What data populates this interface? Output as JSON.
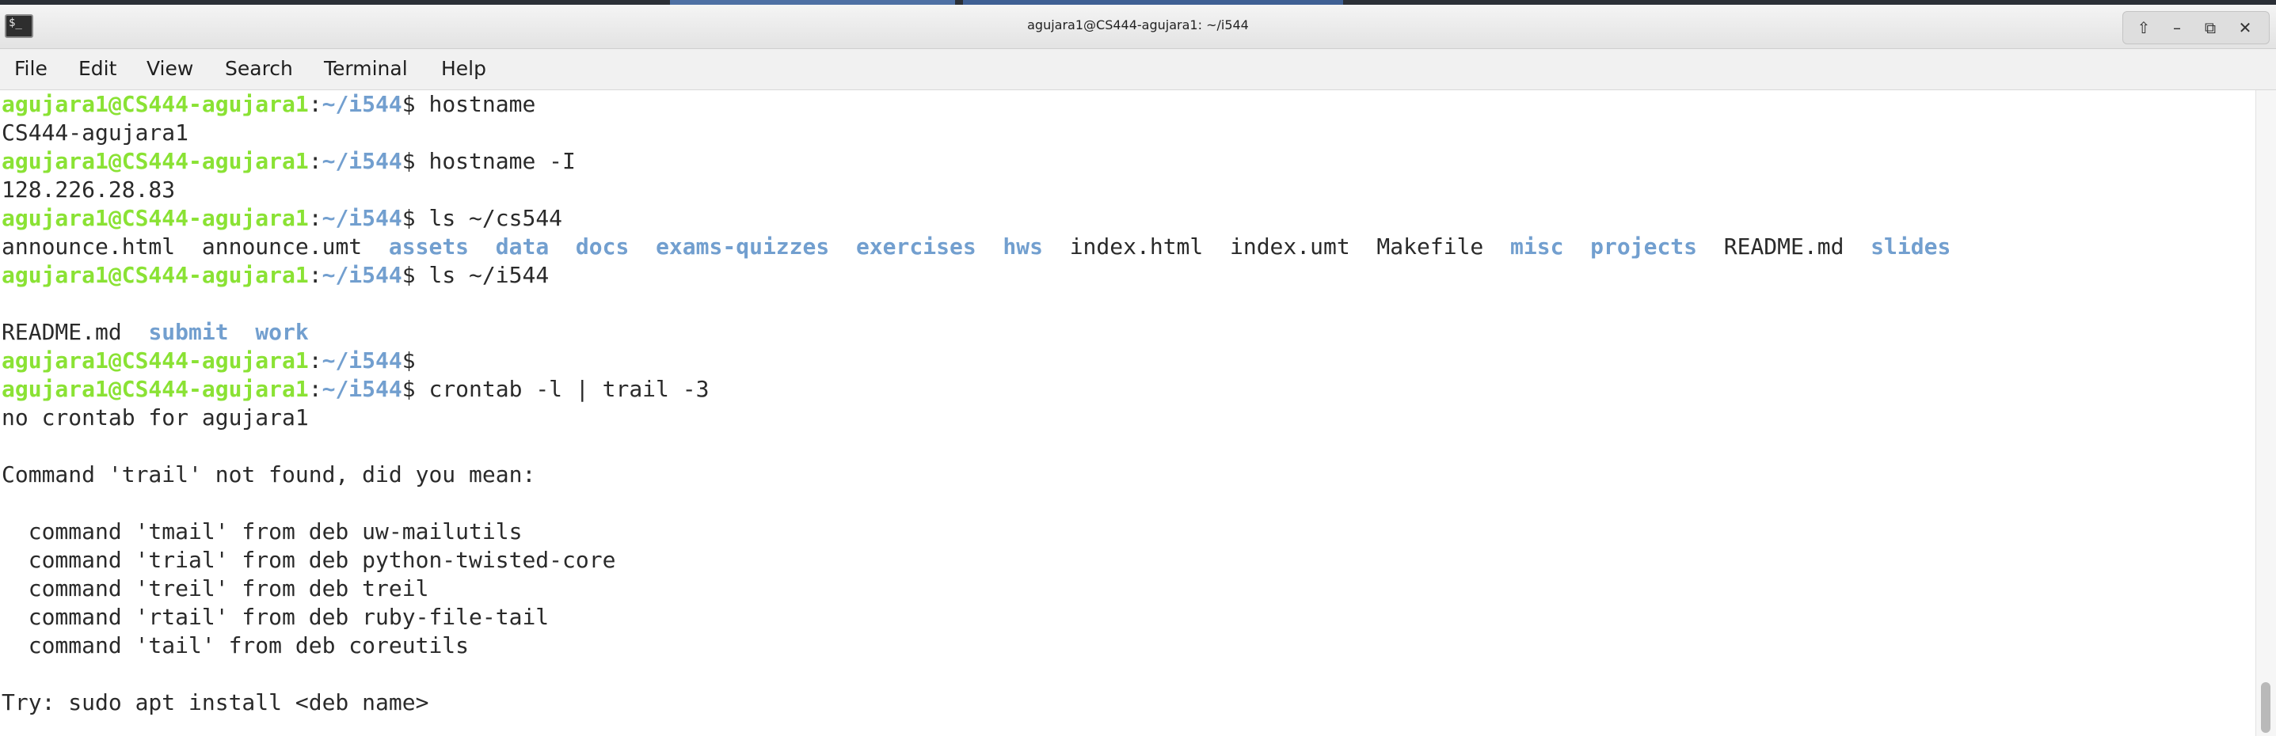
{
  "window": {
    "title": "agujara1@CS444-agujara1: ~/i544",
    "app_icon_glyph": "$_",
    "controls": {
      "up": "⇧",
      "minimize": "–",
      "maximize": "⧉",
      "close": "✕"
    }
  },
  "menu": [
    "File",
    "Edit",
    "View",
    "Search",
    "Terminal",
    "Help"
  ],
  "terminal": {
    "prompt_user": "agujara1@CS444-agujara1",
    "lines": [
      {
        "kind": "prompt",
        "path": "~/i544",
        "cmd": " hostname"
      },
      {
        "kind": "output",
        "text": "CS444-agujara1"
      },
      {
        "kind": "prompt",
        "path": "~/i544",
        "cmd": " hostname -I"
      },
      {
        "kind": "output",
        "text": "128.226.28.83"
      },
      {
        "kind": "prompt",
        "path": "~/i544",
        "cmd": " ls ~/cs544"
      },
      {
        "kind": "ls",
        "items": [
          {
            "name": "announce.html",
            "dir": false
          },
          {
            "name": "announce.umt",
            "dir": false
          },
          {
            "name": "assets",
            "dir": true
          },
          {
            "name": "data",
            "dir": true
          },
          {
            "name": "docs",
            "dir": true
          },
          {
            "name": "exams-quizzes",
            "dir": true
          },
          {
            "name": "exercises",
            "dir": true
          },
          {
            "name": "hws",
            "dir": true
          },
          {
            "name": "index.html",
            "dir": false
          },
          {
            "name": "index.umt",
            "dir": false
          },
          {
            "name": "Makefile",
            "dir": false
          },
          {
            "name": "misc",
            "dir": true
          },
          {
            "name": "projects",
            "dir": true
          },
          {
            "name": "README.md",
            "dir": false
          },
          {
            "name": "slides",
            "dir": true
          }
        ]
      },
      {
        "kind": "prompt",
        "path": "~/i544",
        "cmd": " ls ~/i544"
      },
      {
        "kind": "output",
        "text": ""
      },
      {
        "kind": "ls",
        "items": [
          {
            "name": "README.md",
            "dir": false
          },
          {
            "name": "submit",
            "dir": true
          },
          {
            "name": "work",
            "dir": true
          }
        ]
      },
      {
        "kind": "prompt",
        "path": "~/i544",
        "cmd": ""
      },
      {
        "kind": "prompt",
        "path": "~/i544",
        "cmd": " crontab -l | trail -3"
      },
      {
        "kind": "output",
        "text": "no crontab for agujara1"
      },
      {
        "kind": "output",
        "text": ""
      },
      {
        "kind": "output",
        "text": "Command 'trail' not found, did you mean:"
      },
      {
        "kind": "output",
        "text": ""
      },
      {
        "kind": "output",
        "text": "  command 'tmail' from deb uw-mailutils"
      },
      {
        "kind": "output",
        "text": "  command 'trial' from deb python-twisted-core"
      },
      {
        "kind": "output",
        "text": "  command 'treil' from deb treil"
      },
      {
        "kind": "output",
        "text": "  command 'rtail' from deb ruby-file-tail"
      },
      {
        "kind": "output",
        "text": "  command 'tail' from deb coreutils"
      },
      {
        "kind": "output",
        "text": ""
      },
      {
        "kind": "output",
        "text": "Try: sudo apt install <deb name>"
      }
    ]
  },
  "colors": {
    "prompt_user": "#8ae234",
    "prompt_path": "#729fcf",
    "directory": "#729fcf",
    "text": "#2a2a2a"
  }
}
